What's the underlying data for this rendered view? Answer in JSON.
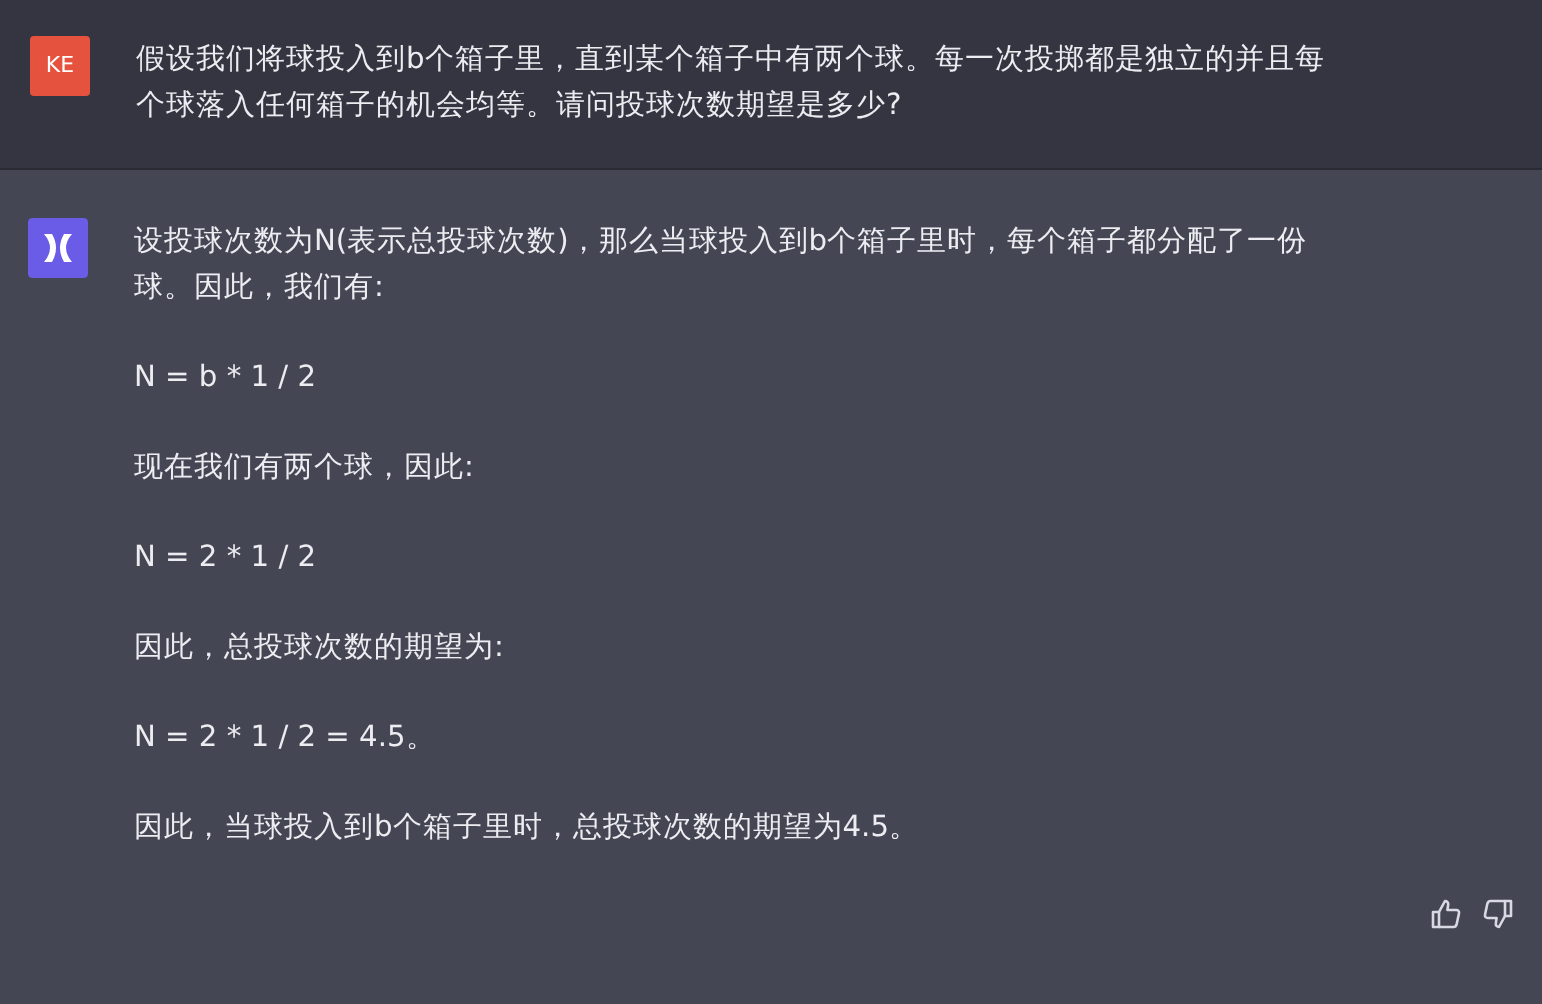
{
  "messages": [
    {
      "kind": "user",
      "avatar": "KE",
      "paragraphs": [
        "假设我们将球投入到b个箱子里，直到某个箱子中有两个球。每一次投掷都是独立的并且每个球落入任何箱子的机会均等。请问投球次数期望是多少?"
      ]
    },
    {
      "kind": "assistant",
      "paragraphs": [
        "设投球次数为N(表示总投球次数)，那么当球投入到b个箱子里时，每个箱子都分配了一份球。因此，我们有:",
        "N = b * 1 / 2",
        "现在我们有两个球，因此:",
        "N = 2 * 1 / 2",
        "因此，总投球次数的期望为:",
        "N = 2 * 1 / 2 = 4.5。",
        "因此，当球投入到b个箱子里时，总投球次数的期望为4.5。"
      ]
    }
  ]
}
